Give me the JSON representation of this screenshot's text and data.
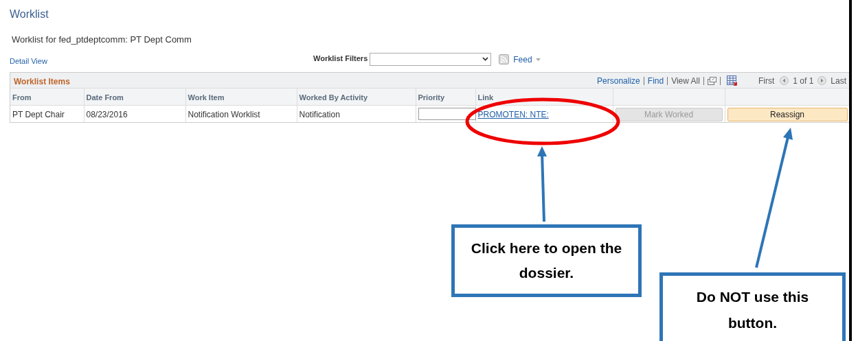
{
  "page": {
    "title": "Worklist",
    "subtitle": "Worklist for fed_ptdeptcomm: PT Dept Comm",
    "detail_view_link": "Detail View"
  },
  "filters": {
    "label": "Worklist Filters",
    "feed_link": "Feed"
  },
  "grid": {
    "title": "Worklist Items",
    "toolbar_links": [
      "Personalize",
      "Find",
      "View All"
    ],
    "nav": {
      "first": "First",
      "page": "1 of 1",
      "last": "Last"
    },
    "columns": [
      "From",
      "Date From",
      "Work Item",
      "Worked By Activity",
      "Priority",
      "Link"
    ],
    "rows": [
      {
        "from": "PT Dept Chair",
        "date_from": "08/23/2016",
        "work_item": "Notification Worklist",
        "worked_by_activity": "Notification",
        "link": "PROMOTEN: NTE:",
        "buttons": [
          {
            "label": "Mark Worked",
            "disabled": true
          },
          {
            "label": "Reassign",
            "disabled": false
          }
        ]
      }
    ]
  },
  "callouts": [
    {
      "text": "Click here to open the dossier."
    },
    {
      "text": "Do NOT use this button."
    }
  ]
}
